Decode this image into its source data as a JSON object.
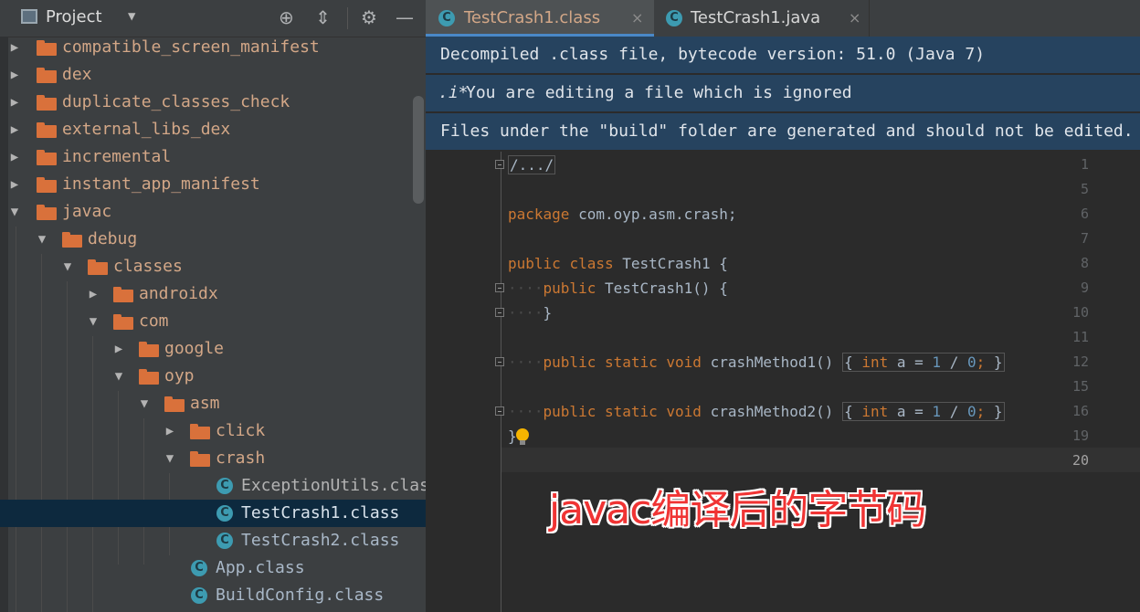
{
  "project_panel": {
    "title": "Project",
    "tree": [
      {
        "label": "compatible_screen_manifest",
        "type": "folder",
        "expanded": false
      },
      {
        "label": "dex",
        "type": "folder",
        "expanded": false
      },
      {
        "label": "duplicate_classes_check",
        "type": "folder",
        "expanded": false
      },
      {
        "label": "external_libs_dex",
        "type": "folder",
        "expanded": false
      },
      {
        "label": "incremental",
        "type": "folder",
        "expanded": false
      },
      {
        "label": "instant_app_manifest",
        "type": "folder",
        "expanded": false
      },
      {
        "label": "javac",
        "type": "folder",
        "expanded": true
      },
      {
        "label": "debug",
        "type": "folder",
        "expanded": true
      },
      {
        "label": "classes",
        "type": "folder",
        "expanded": true
      },
      {
        "label": "androidx",
        "type": "folder",
        "expanded": false
      },
      {
        "label": "com",
        "type": "folder",
        "expanded": true
      },
      {
        "label": "google",
        "type": "folder",
        "expanded": false
      },
      {
        "label": "oyp",
        "type": "folder",
        "expanded": true
      },
      {
        "label": "asm",
        "type": "folder",
        "expanded": true
      },
      {
        "label": "click",
        "type": "folder",
        "expanded": false
      },
      {
        "label": "crash",
        "type": "folder",
        "expanded": true
      },
      {
        "label": "ExceptionUtils.class",
        "type": "class"
      },
      {
        "label": "TestCrash1.class",
        "type": "class",
        "selected": true
      },
      {
        "label": "TestCrash2.class",
        "type": "class"
      },
      {
        "label": "App.class",
        "type": "class"
      },
      {
        "label": "BuildConfig.class",
        "type": "class"
      }
    ]
  },
  "editor": {
    "tabs": [
      {
        "label": "TestCrash1.class",
        "active": true
      },
      {
        "label": "TestCrash1.java",
        "active": false
      }
    ],
    "tab_close_glyph": "×",
    "banners": [
      "Decompiled .class file, bytecode version: 51.0 (Java 7)",
      "You are editing a file which is ignored",
      "Files under the \"build\" folder are generated and should not be edited."
    ],
    "banner_icon": ".i*",
    "line_numbers": [
      "1",
      "5",
      "6",
      "7",
      "8",
      "9",
      "10",
      "11",
      "12",
      "15",
      "16",
      "19",
      "20"
    ],
    "code": {
      "l1": "/.../",
      "l6_kw": "package",
      "l6_rest": " com.oyp.asm.crash;",
      "l8_kw1": "public",
      "l8_kw2": "class",
      "l8_rest": " TestCrash1 {",
      "l9_kw": "public",
      "l9_rest": " TestCrash1() {",
      "l10": "}",
      "l12_kw1": "public",
      "l12_kw2": "static",
      "l12_kw3": "void",
      "l12_name": " crashMethod1() ",
      "l12_open": "{",
      "l12_int": "int",
      "l12_a": " a = ",
      "l12_one": "1",
      "l12_div": " / ",
      "l12_zero": "0",
      "l12_semi": ";",
      "l12_close": "}",
      "l16_name": " crashMethod2() ",
      "l19": "}"
    }
  },
  "overlay_caption": "javac编译后的字节码",
  "colors": {
    "keyword": "#cc7832",
    "number": "#6897bb",
    "folder": "#d9713b",
    "banner_bg": "#26435f",
    "caption": "#f03434"
  }
}
